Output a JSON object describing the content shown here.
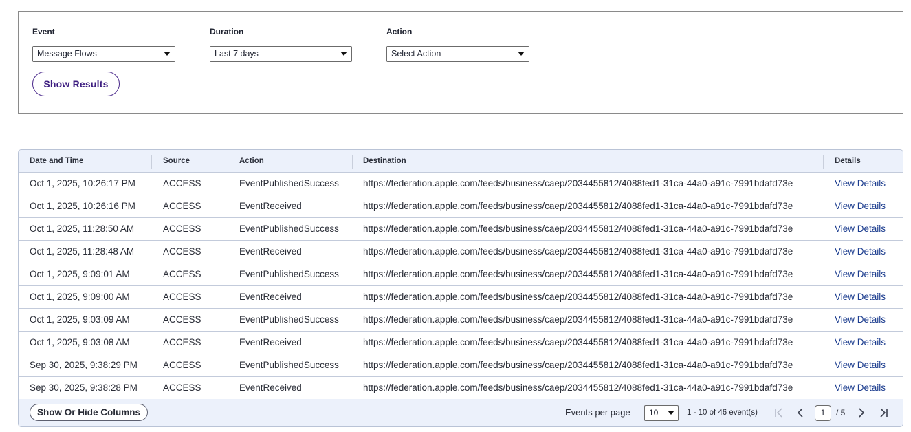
{
  "filters": {
    "event": {
      "label": "Event",
      "value": "Message Flows"
    },
    "duration": {
      "label": "Duration",
      "value": "Last 7 days"
    },
    "action": {
      "label": "Action",
      "value": "Select Action"
    },
    "show_results_label": "Show Results"
  },
  "table": {
    "columns": [
      "Date and Time",
      "Source",
      "Action",
      "Destination",
      "Details"
    ],
    "rows": [
      {
        "date": "Oct 1, 2025, 10:26:17 PM",
        "source": "ACCESS",
        "action": "EventPublishedSuccess",
        "destination": "https://federation.apple.com/feeds/business/caep/2034455812/4088fed1-31ca-44a0-a91c-7991bdafd73e",
        "details": "View Details"
      },
      {
        "date": "Oct 1, 2025, 10:26:16 PM",
        "source": "ACCESS",
        "action": "EventReceived",
        "destination": "https://federation.apple.com/feeds/business/caep/2034455812/4088fed1-31ca-44a0-a91c-7991bdafd73e",
        "details": "View Details"
      },
      {
        "date": "Oct 1, 2025, 11:28:50 AM",
        "source": "ACCESS",
        "action": "EventPublishedSuccess",
        "destination": "https://federation.apple.com/feeds/business/caep/2034455812/4088fed1-31ca-44a0-a91c-7991bdafd73e",
        "details": "View Details"
      },
      {
        "date": "Oct 1, 2025, 11:28:48 AM",
        "source": "ACCESS",
        "action": "EventReceived",
        "destination": "https://federation.apple.com/feeds/business/caep/2034455812/4088fed1-31ca-44a0-a91c-7991bdafd73e",
        "details": "View Details"
      },
      {
        "date": "Oct 1, 2025, 9:09:01 AM",
        "source": "ACCESS",
        "action": "EventPublishedSuccess",
        "destination": "https://federation.apple.com/feeds/business/caep/2034455812/4088fed1-31ca-44a0-a91c-7991bdafd73e",
        "details": "View Details"
      },
      {
        "date": "Oct 1, 2025, 9:09:00 AM",
        "source": "ACCESS",
        "action": "EventReceived",
        "destination": "https://federation.apple.com/feeds/business/caep/2034455812/4088fed1-31ca-44a0-a91c-7991bdafd73e",
        "details": "View Details"
      },
      {
        "date": "Oct 1, 2025, 9:03:09 AM",
        "source": "ACCESS",
        "action": "EventPublishedSuccess",
        "destination": "https://federation.apple.com/feeds/business/caep/2034455812/4088fed1-31ca-44a0-a91c-7991bdafd73e",
        "details": "View Details"
      },
      {
        "date": "Oct 1, 2025, 9:03:08 AM",
        "source": "ACCESS",
        "action": "EventReceived",
        "destination": "https://federation.apple.com/feeds/business/caep/2034455812/4088fed1-31ca-44a0-a91c-7991bdafd73e",
        "details": "View Details"
      },
      {
        "date": "Sep 30, 2025, 9:38:29 PM",
        "source": "ACCESS",
        "action": "EventPublishedSuccess",
        "destination": "https://federation.apple.com/feeds/business/caep/2034455812/4088fed1-31ca-44a0-a91c-7991bdafd73e",
        "details": "View Details"
      },
      {
        "date": "Sep 30, 2025, 9:38:28 PM",
        "source": "ACCESS",
        "action": "EventReceived",
        "destination": "https://federation.apple.com/feeds/business/caep/2034455812/4088fed1-31ca-44a0-a91c-7991bdafd73e",
        "details": "View Details"
      }
    ]
  },
  "footer": {
    "show_hide_columns_label": "Show Or Hide Columns",
    "events_per_page_label": "Events per page",
    "events_per_page_value": "10",
    "range_text": "1 - 10 of 46 event(s)",
    "current_page": "1",
    "total_pages_text": "/ 5"
  },
  "icons": {
    "first_page": "first-page-icon",
    "prev_page": "chevron-left-icon",
    "next_page": "chevron-right-icon",
    "last_page": "last-page-icon"
  },
  "colors": {
    "accent": "#3d1d80",
    "link": "#1c3d8f",
    "header_bg": "#ecf1fb"
  }
}
